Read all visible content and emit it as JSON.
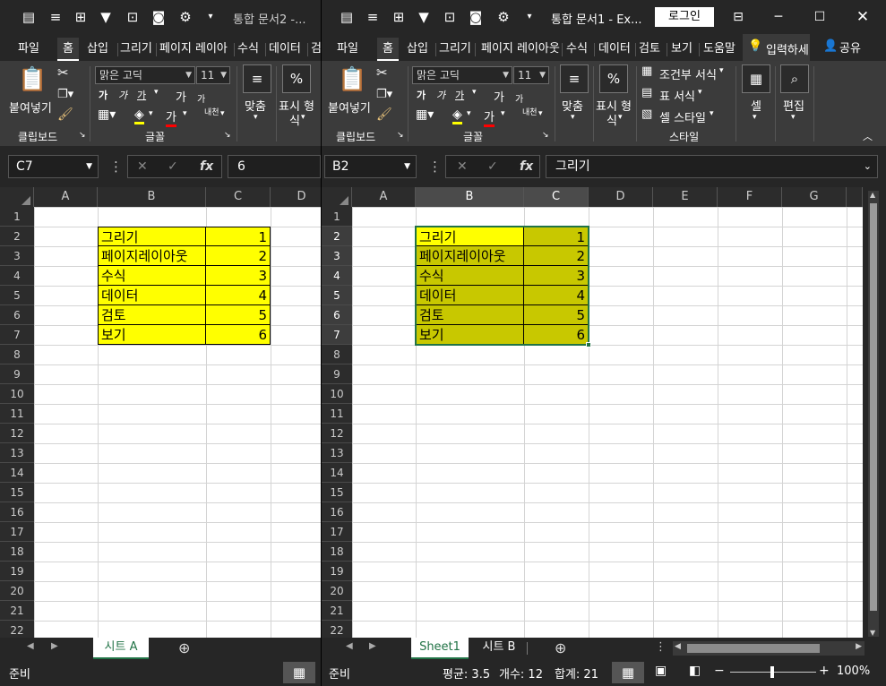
{
  "left_window": {
    "title": "통합 문서2  -...",
    "tabs": [
      "파일",
      "홈",
      "삽입",
      "그리기",
      "페이지 레이아",
      "수식",
      "데이터",
      "검"
    ],
    "selected_tab": "홈",
    "ribbon": {
      "paste_label": "붙여넣기",
      "font_name": "맑은 고딕",
      "font_size": "11",
      "align_label": "맞춤",
      "number_label": "표시 형",
      "number_label_2": "식",
      "group_clipboard": "클립보드",
      "group_font": "글꼴"
    },
    "name_box": "C7",
    "formula_value": "6",
    "columns": [
      "A",
      "B",
      "C",
      "D"
    ],
    "rows": [
      "1",
      "2",
      "3",
      "4",
      "5",
      "6",
      "7",
      "8",
      "9",
      "10",
      "11",
      "12",
      "13",
      "14",
      "15",
      "16",
      "17",
      "18",
      "19",
      "20",
      "21",
      "22"
    ],
    "table": [
      {
        "label": "그리기",
        "value": "1"
      },
      {
        "label": "페이지레이아웃",
        "value": "2"
      },
      {
        "label": "수식",
        "value": "3"
      },
      {
        "label": "데이터",
        "value": "4"
      },
      {
        "label": "검토",
        "value": "5"
      },
      {
        "label": "보기",
        "value": "6"
      }
    ],
    "sheet_tab": "시트 A",
    "status": "준비"
  },
  "right_window": {
    "title": "통합 문서1  -  Ex...",
    "login_label": "로그인",
    "tabs": [
      "파일",
      "홈",
      "삽입",
      "그리기",
      "페이지 레이아웃",
      "수식",
      "데이터",
      "검토",
      "보기",
      "도움말"
    ],
    "selected_tab": "홈",
    "tell_me": "입력하세",
    "share": "공유",
    "ribbon": {
      "paste_label": "붙여넣기",
      "font_name": "맑은 고딕",
      "font_size": "11",
      "align_label": "맞춤",
      "number_label": "표시 형",
      "number_label_2": "식",
      "cond_format": "조건부 서식",
      "table_format": "표 서식",
      "cell_style": "셀 스타일",
      "cells_label": "셀",
      "edit_label": "편집",
      "group_clipboard": "클립보드",
      "group_font": "글꼴",
      "group_style": "스타일"
    },
    "name_box": "B2",
    "formula_value": "그리기",
    "columns": [
      "A",
      "B",
      "C",
      "D",
      "E",
      "F",
      "G"
    ],
    "rows": [
      "1",
      "2",
      "3",
      "4",
      "5",
      "6",
      "7",
      "8",
      "9",
      "10",
      "11",
      "12",
      "13",
      "14",
      "15",
      "16",
      "17",
      "18",
      "19",
      "20",
      "21",
      "22"
    ],
    "table": [
      {
        "label": "그리기",
        "value": "1"
      },
      {
        "label": "페이지레이아웃",
        "value": "2"
      },
      {
        "label": "수식",
        "value": "3"
      },
      {
        "label": "데이터",
        "value": "4"
      },
      {
        "label": "검토",
        "value": "5"
      },
      {
        "label": "보기",
        "value": "6"
      }
    ],
    "sheet_tabs": [
      "Sheet1",
      "시트 B"
    ],
    "status": "준비",
    "average": "평균: 3.5",
    "count": "개수: 12",
    "sum": "합계: 21",
    "zoom": "100%"
  },
  "colors": {
    "yellow": "#ffff00",
    "selected_fill": "#c8c800",
    "accent": "#217346"
  }
}
